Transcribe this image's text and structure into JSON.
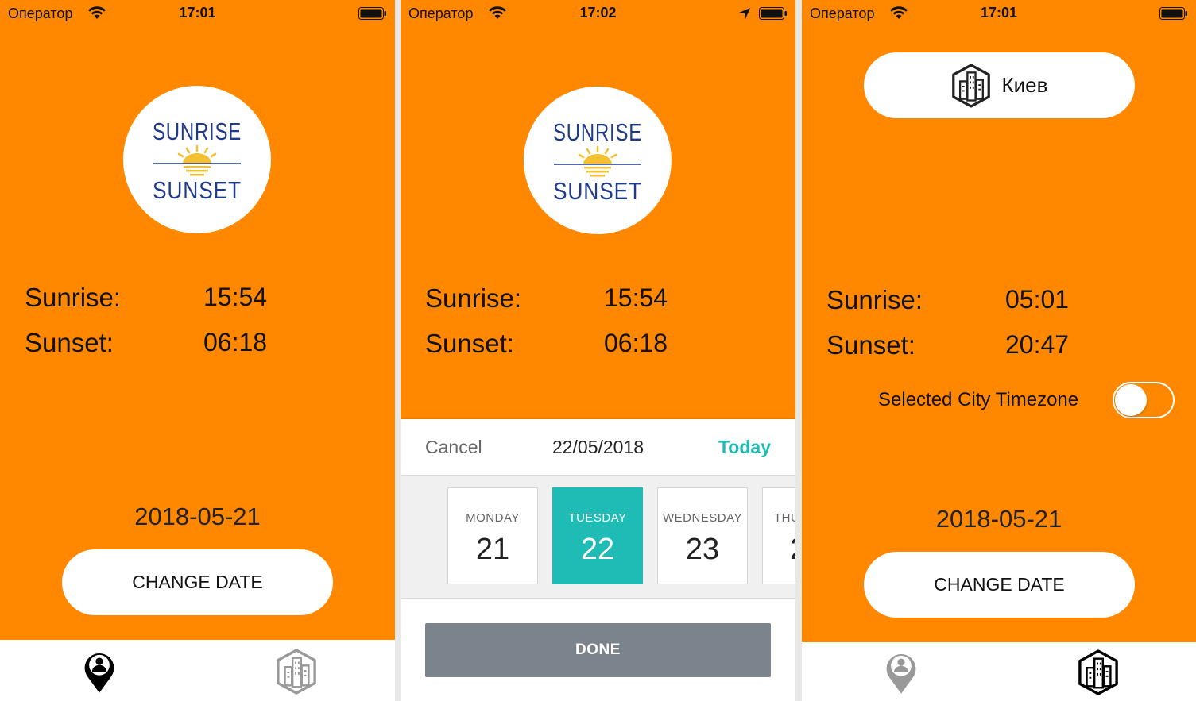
{
  "screens": [
    {
      "status": {
        "carrier": "Оператор",
        "time": "17:01"
      },
      "logo": {
        "line1": "SUNRISE",
        "line2": "SUNSET"
      },
      "sunrise_label": "Sunrise:",
      "sunrise_value": "15:54",
      "sunset_label": "Sunset:",
      "sunset_value": "06:18",
      "date": "2018-05-21",
      "change_date": "CHANGE DATE",
      "tabs": [
        {
          "icon": "location-person-icon",
          "active": true
        },
        {
          "icon": "city-buildings-icon",
          "active": false
        }
      ]
    },
    {
      "status": {
        "carrier": "Оператор",
        "time": "17:02"
      },
      "logo": {
        "line1": "SUNRISE",
        "line2": "SUNSET"
      },
      "sunrise_label": "Sunrise:",
      "sunrise_value": "15:54",
      "sunset_label": "Sunset:",
      "sunset_value": "06:18",
      "picker": {
        "cancel": "Cancel",
        "selected_date": "22/05/2018",
        "today": "Today",
        "days": [
          {
            "dow": "MONDAY",
            "num": "21",
            "selected": false
          },
          {
            "dow": "TUESDAY",
            "num": "22",
            "selected": true
          },
          {
            "dow": "WEDNESDAY",
            "num": "23",
            "selected": false
          },
          {
            "dow": "THU",
            "num": "2",
            "selected": false
          }
        ],
        "done": "DONE"
      }
    },
    {
      "status": {
        "carrier": "Оператор",
        "time": "17:01"
      },
      "city": "Киев",
      "sunrise_label": "Sunrise:",
      "sunrise_value": "05:01",
      "sunset_label": "Sunset:",
      "sunset_value": "20:47",
      "toggle_label": "Selected City Timezone",
      "toggle_on": false,
      "date": "2018-05-21",
      "change_date": "CHANGE DATE",
      "tabs": [
        {
          "icon": "location-person-icon",
          "active": false
        },
        {
          "icon": "city-buildings-icon",
          "active": true
        }
      ]
    }
  ],
  "colors": {
    "background": "#ff8800",
    "accent": "#1fbcb5",
    "done_button": "#7b838c"
  }
}
